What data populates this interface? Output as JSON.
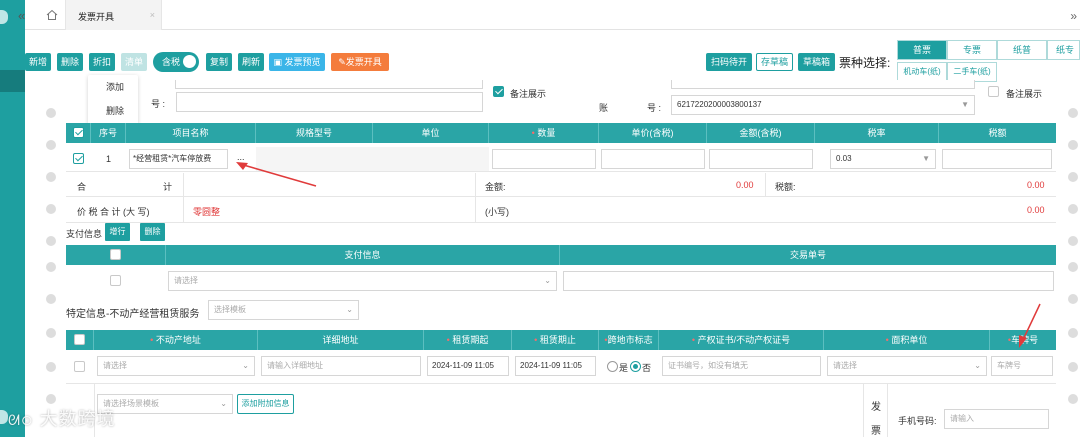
{
  "topbar": {
    "tab_label": "发票开具",
    "tab_close": "×"
  },
  "toolbar": {
    "new": "新增",
    "delete": "删除",
    "discount": "折扣",
    "clear": "清单",
    "tax_included": "含税",
    "copy": "复制",
    "refresh": "刷新",
    "preview": "发票预览",
    "issue": "发票开具",
    "scan_pending": "扫码待开",
    "save_draft": "存草稿",
    "draft_box": "草稿箱",
    "ticket_type_label": "票种选择:"
  },
  "dropdown_menu": {
    "add": "添加",
    "delete": "删除"
  },
  "ticket_types": {
    "row1": [
      "普票",
      "专票",
      "纸普",
      "纸专"
    ],
    "row2": [
      "机动车(纸)",
      "二手车(纸)"
    ]
  },
  "buyer": {
    "number_label": "号 :",
    "remark_show": "备注展示",
    "account_label": "账",
    "account_suffix": "号 :",
    "account_value": "6217220200003800137",
    "remark_show_right": "备注展示"
  },
  "items_table": {
    "headers": [
      "序号",
      "项目名称",
      "规格型号",
      "单位",
      "数量",
      "单价(含税)",
      "金额(含税)",
      "税率",
      "税额"
    ],
    "rows": [
      {
        "index": "1",
        "name": "*经营租赁*汽车停放费",
        "more": "...",
        "tax_rate": "0.03"
      }
    ]
  },
  "totals": {
    "total_label_a": "合",
    "total_label_b": "计",
    "amount_label": "金额:",
    "amount_value": "0.00",
    "tax_label": "税额:",
    "tax_value": "0.00",
    "grand_label": "价 税 合 计 (大 写)",
    "grand_caps": "零圆整",
    "small_label": "(小写)",
    "small_value": "0.00"
  },
  "payment": {
    "section_label": "支付信息",
    "add_button": "增行",
    "delete_button": "删除",
    "headers": [
      "支付信息",
      "交易单号"
    ],
    "select_placeholder": "请选择"
  },
  "special": {
    "label": "特定信息-不动产经营租赁服务",
    "template_placeholder": "选择模板",
    "headers": [
      "不动产地址",
      "详细地址",
      "租赁期起",
      "租赁期止",
      "跨地市标志",
      "产权证书/不动产权证号",
      "面积单位",
      "车牌号"
    ],
    "row": {
      "address_placeholder": "请选择",
      "detail_placeholder": "请输入详细地址",
      "start": "2024-11-09 11:05",
      "end": "2024-11-09 11:05",
      "yes": "是",
      "no": "否",
      "cert_placeholder": "证书编号，如没有填无",
      "area_placeholder": "请选择",
      "plate_placeholder": "车牌号"
    }
  },
  "bottom": {
    "scene_placeholder": "请选择场景模板",
    "add_extra": "添加附加信息",
    "invoice_side": "发",
    "invoice_side2": "票",
    "phone_label": "手机号码:",
    "phone_placeholder": "请输入"
  },
  "watermark": "大数跨境",
  "colors": {
    "accent": "#1e9fa0",
    "header": "#2aa5a6",
    "danger": "#e03b3b",
    "blue": "#3ab5e8",
    "orange": "#f47c3c"
  }
}
